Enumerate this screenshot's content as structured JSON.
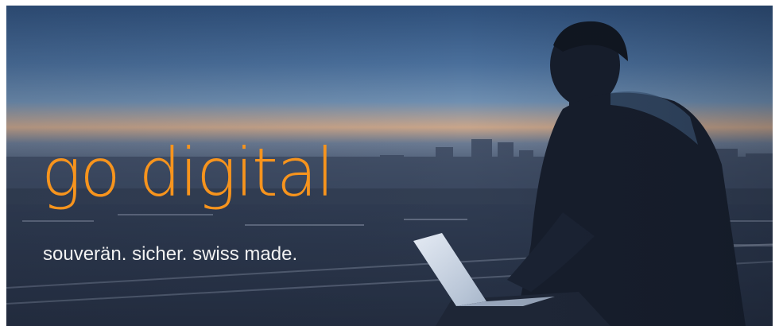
{
  "banner": {
    "headline": "go digital",
    "tagline": "souverän. sicher. swiss made."
  },
  "colors": {
    "headline": "#f7941d",
    "tagline": "#f2f2f2",
    "sky_top": "#3b5c86",
    "sky_horizon": "#e0a878"
  },
  "icons": [
    "laptop-icon",
    "person-silhouette"
  ]
}
